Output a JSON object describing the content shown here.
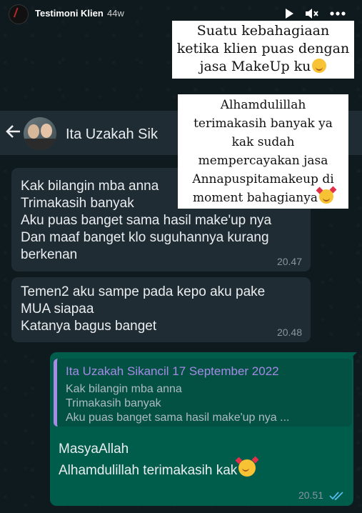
{
  "story": {
    "username": "Testimoni Klien",
    "time_ago": "44w"
  },
  "captions": {
    "top": [
      "Suatu kebahagiaan",
      "ketika klien puas dengan",
      "jasa MakeUp ku"
    ],
    "middle": [
      "Alhamdulillah",
      "terimakasih banyak ya",
      "kak sudah",
      "mempercayakan jasa",
      "Annapuspitamakeup di",
      "moment bahagianya"
    ]
  },
  "chat": {
    "contact_name": "Ita Uzakah Sikancil",
    "contact_name_visible": "Ita Uzakah Sik"
  },
  "messages": [
    {
      "direction": "in",
      "lines": [
        "Kak bilangin mba anna",
        "Trimakasih banyak",
        "Aku puas banget sama hasil make'up nya",
        "Dan maaf banget klo suguhannya kurang",
        "berkenan"
      ],
      "time": "20.47"
    },
    {
      "direction": "in",
      "lines": [
        "Temen2 aku sampe pada kepo aku pake",
        "MUA siapaa",
        "Katanya bagus banget"
      ],
      "time": "20.48"
    },
    {
      "direction": "out",
      "quote_author": "Ita Uzakah Sikancil 17 September 2022",
      "quote_lines": [
        "Kak bilangin mba anna",
        "Trimakasih banyak",
        "Aku puas banget sama hasil make'up nya ..."
      ],
      "lines": [
        "MasyaAllah",
        "Alhamdulillah terimakasih kak"
      ],
      "time": "20.51",
      "status": "read"
    }
  ],
  "icons": {
    "play": "play-icon",
    "mute": "mute-icon",
    "more": "more-icon",
    "back": "back-arrow-icon",
    "read_status": "double-check-icon"
  },
  "colors": {
    "incoming_bubble": "#202c33",
    "outgoing_bubble": "#005c4b",
    "quote_accent": "#a58ae6",
    "read_ticks": "#53bdeb"
  }
}
